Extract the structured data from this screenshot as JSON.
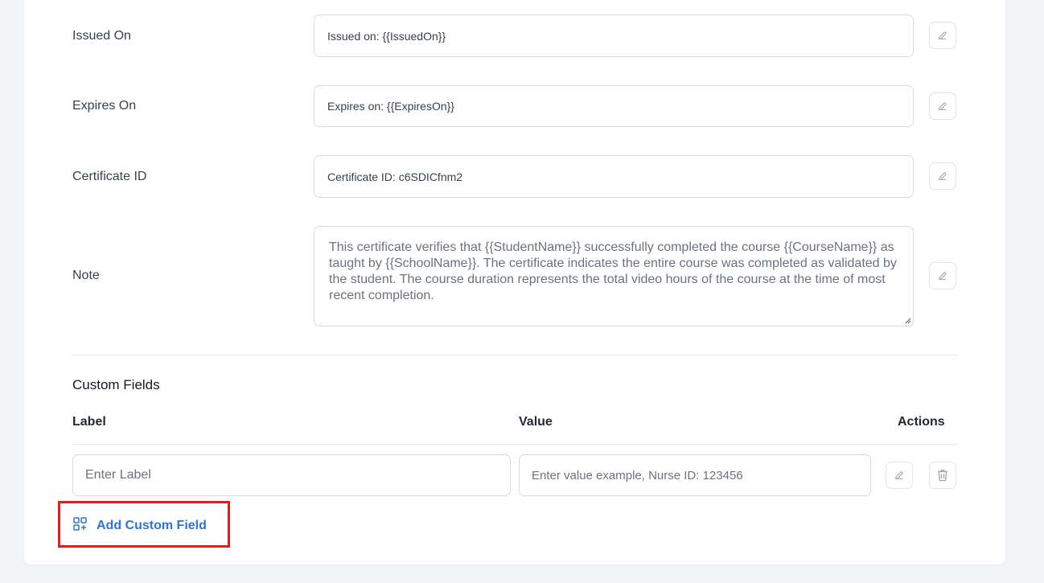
{
  "rows": {
    "issued_on": {
      "label": "Issued On",
      "value": "Issued on: {{IssuedOn}}"
    },
    "expires_on": {
      "label": "Expires On",
      "value": "Expires on: {{ExpiresOn}}"
    },
    "certificate_id": {
      "label": "Certificate ID",
      "value": "Certificate ID: c6SDICfnm2"
    },
    "note": {
      "label": "Note",
      "value": "This certificate verifies that {{StudentName}} successfully completed the course {{CourseName}} as taught by {{SchoolName}}. The certificate indicates the entire course was completed as validated by the student. The course duration represents the total video hours of the course at the time of most recent completion."
    }
  },
  "custom_fields": {
    "title": "Custom Fields",
    "columns": {
      "label": "Label",
      "value": "Value",
      "actions": "Actions"
    },
    "row": {
      "label_placeholder": "Enter Label",
      "value_placeholder": "Enter value example, Nurse ID: 123456"
    },
    "add_button": "Add Custom Field"
  },
  "colors": {
    "accent": "#2f74d9",
    "highlight": "#e11d1d"
  }
}
